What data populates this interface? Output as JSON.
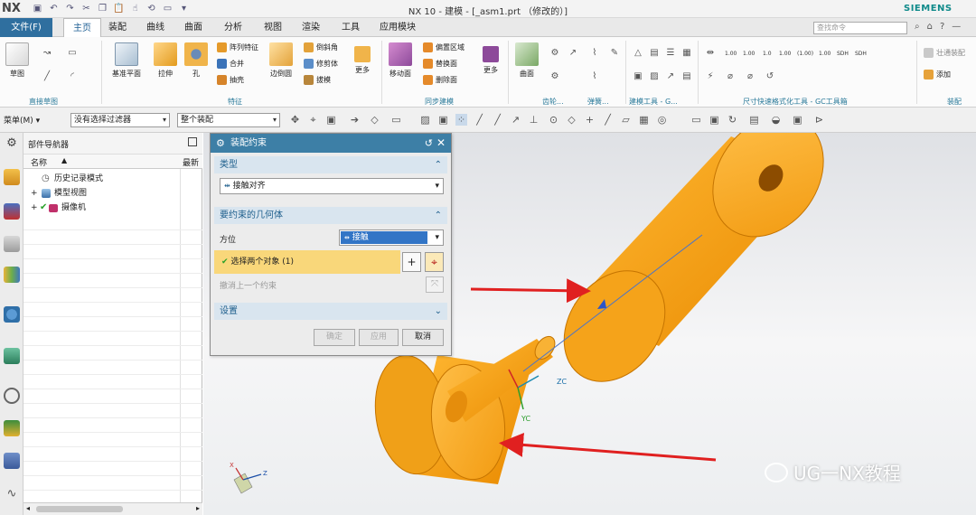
{
  "app": {
    "logo": "NX",
    "title": "NX 10 - 建模 - [_asm1.prt （修改的）]",
    "brand": "SIEMENS"
  },
  "tabs": [
    "文件(F)",
    "主页",
    "装配",
    "曲线",
    "曲面",
    "分析",
    "视图",
    "渲染",
    "工具",
    "应用模块"
  ],
  "search_placeholder": "查找命令",
  "ribbon": {
    "direct_sketch": {
      "label": "直接草图",
      "sketch": "草图"
    },
    "feature": {
      "label": "特征",
      "datum_plane": "基准平面",
      "extrude": "拉伸",
      "hole": "孔",
      "pattern": "阵列特征",
      "unite": "合并",
      "shell": "抽壳",
      "edge_blend": "边倒圆",
      "chamfer": "倒斜角",
      "trim": "修剪体",
      "draft": "拔模",
      "more": "更多"
    },
    "sync": {
      "label": "同步建模",
      "move_face": "移动面",
      "offset_region": "偏置区域",
      "replace_face": "替换面",
      "delete_face": "删除面",
      "more": "更多"
    },
    "surface": {
      "face": "曲面",
      "label": "齿轮..."
    },
    "spring": {
      "label": "弹簧..."
    },
    "build_tools": {
      "label": "建模工具 - G..."
    },
    "dim_tools": {
      "label": "尺寸快速格式化工具 - GC工具箱",
      "values": [
        "1.00",
        "1.00",
        "1.0",
        "1.00",
        "(1.00)",
        "1.00",
        "SDH",
        "SDH"
      ]
    },
    "assembly": {
      "label": "装配",
      "add": "添加",
      "constraint": "壮通装配"
    }
  },
  "toolbar": {
    "menu": "菜单(M) ▾",
    "filter": "没有选择过滤器",
    "scope": "整个装配"
  },
  "navigator": {
    "title": "部件导航器",
    "col_name": "名称",
    "col_latest": "最新",
    "items": [
      "历史记录模式",
      "模型视图",
      "摄像机"
    ]
  },
  "dialog": {
    "title": "装配约束",
    "type_section": "类型",
    "type_value": "接触对齐",
    "geom_section": "要约束的几何体",
    "orient_label": "方位",
    "orient_value": "接触",
    "select_label": "选择两个对象 (1)",
    "undo_label": "撤消上一个约束",
    "settings_section": "设置",
    "ok": "确定",
    "apply": "应用",
    "cancel": "取消"
  },
  "viewport": {
    "zc": "ZC",
    "yc": "YC",
    "axis_z": "Z",
    "axis_x": "X",
    "watermark": "UG一NX教程",
    "part_color": "#f5a31a",
    "arrow_color": "#e02020"
  }
}
